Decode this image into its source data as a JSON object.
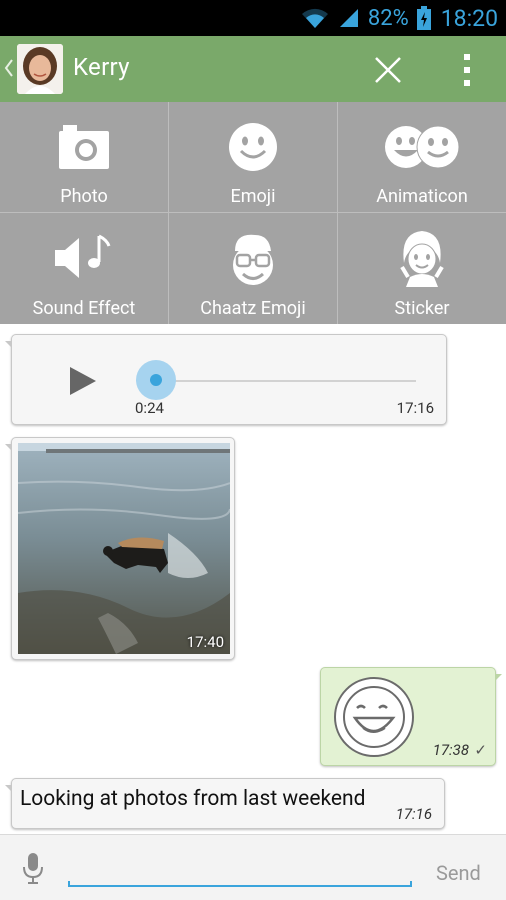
{
  "status_bar": {
    "battery": "82%",
    "time": "18:20"
  },
  "header": {
    "contact_name": "Kerry"
  },
  "attachments": [
    {
      "label": "Photo",
      "icon": "camera-icon"
    },
    {
      "label": "Emoji",
      "icon": "smiley-icon"
    },
    {
      "label": "Animaticon",
      "icon": "animaticon-icon"
    },
    {
      "label": "Sound Effect",
      "icon": "speaker-music-icon"
    },
    {
      "label": "Chaatz Emoji",
      "icon": "chaatz-face-icon"
    },
    {
      "label": "Sticker",
      "icon": "sticker-girl-icon"
    }
  ],
  "messages": {
    "audio": {
      "elapsed": "0:24",
      "time": "17:16",
      "progress": 0.0
    },
    "photo": {
      "time": "17:40"
    },
    "sticker": {
      "time": "17:38",
      "status": "✓"
    },
    "text": {
      "body": "Looking at photos from last weekend",
      "time": "17:16"
    }
  },
  "composer": {
    "send_label": "Send"
  },
  "colors": {
    "header": "#7aa96a",
    "accent": "#3aa4dc",
    "grid": "#a3a3a3",
    "outgoing_bubble": "#e3f2d3"
  }
}
